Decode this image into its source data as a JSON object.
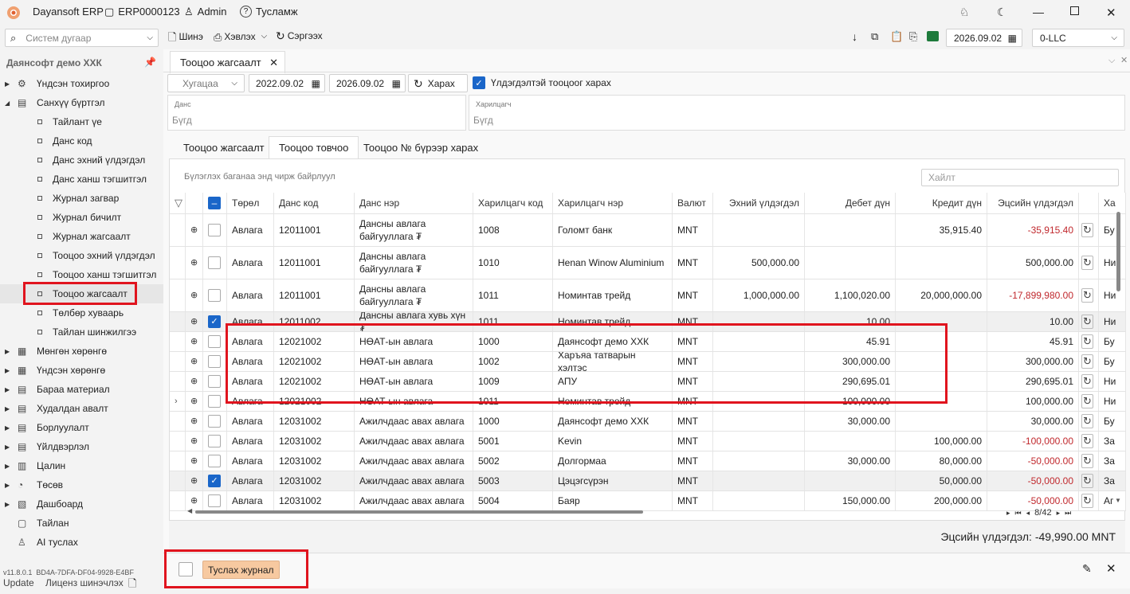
{
  "titlebar": {
    "app_name": "Dayansoft ERP",
    "db_name": "ERP0000123",
    "user": "Admin",
    "help": "Тусламж"
  },
  "toolbar": {
    "search_placeholder": "Систем дугаар",
    "new_label": "Шинэ",
    "print_label": "Хэвлэх",
    "refresh_label": "Сэргээх",
    "date": "2026.09.02",
    "company": "0-LLC"
  },
  "sidebar": {
    "company": "Даянсофт демо ХХК",
    "items_top": [
      {
        "label": "Үндсэн тохиргоо",
        "glyph": "⚙",
        "arrow": "▶"
      },
      {
        "label": "Санхүү бүртгэл",
        "glyph": "▤",
        "arrow": "◢"
      }
    ],
    "subitems": [
      "Тайлант үе",
      "Данс код",
      "Данс эхний үлдэгдэл",
      "Данс ханш тэгшитгэл",
      "Журнал загвар",
      "Журнал бичилт",
      "Журнал жагсаалт",
      "Тооцоо эхний үлдэгдэл",
      "Тооцоо ханш тэгшитгэл",
      "Тооцоо жагсаалт",
      "Төлбөр хуваарь",
      "Тайлан шинжилгээ"
    ],
    "items_bottom": [
      {
        "label": "Мөнгөн хөрөнгө",
        "glyph": "▦",
        "arrow": "▶"
      },
      {
        "label": "Үндсэн хөрөнгө",
        "glyph": "▦",
        "arrow": "▶"
      },
      {
        "label": "Бараа материал",
        "glyph": "▤",
        "arrow": "▶"
      },
      {
        "label": "Худалдан авалт",
        "glyph": "▤",
        "arrow": "▶"
      },
      {
        "label": "Борлуулалт",
        "glyph": "▤",
        "arrow": "▶"
      },
      {
        "label": "Үйлдвэрлэл",
        "glyph": "▤",
        "arrow": "▶"
      },
      {
        "label": "Цалин",
        "glyph": "▥",
        "arrow": "▶"
      },
      {
        "label": "Төсөв",
        "glyph": "◔",
        "arrow": "▶"
      },
      {
        "label": "Дашбоард",
        "glyph": "▧",
        "arrow": "▶"
      },
      {
        "label": "Тайлан",
        "glyph": "▢",
        "arrow": ""
      },
      {
        "label": "AI туслах",
        "glyph": "♙",
        "arrow": ""
      }
    ],
    "version": "v11.8.0.1",
    "license_key": "BD4A-7DFA-DF04-9928-E4BF",
    "update_label": "Update",
    "license_label": "Лиценз шинэчлэх"
  },
  "doc_tab": {
    "title": "Тооцоо жагсаалт"
  },
  "filters": {
    "period": "Хугацаа",
    "date_from": "2022.09.02",
    "date_to": "2026.09.02",
    "view_label": "Харах",
    "balance_only_label": "Үлдэгдэлтэй тооцоог харах",
    "account_label": "Данс",
    "account_value": "Бүгд",
    "partner_label": "Харилцагч",
    "partner_value": "Бүгд"
  },
  "subtabs": [
    "Тооцоо жагсаалт",
    "Тооцоо товчоо",
    "Тооцоо № бүрээр харах"
  ],
  "grid": {
    "group_hint": "Бүлэглэх баганаа энд чирж байрлуул",
    "search_placeholder": "Хайлт",
    "columns": [
      "Төрөл",
      "Данс код",
      "Данс нэр",
      "Харилцагч код",
      "Харилцагч нэр",
      "Валют",
      "Эхний үлдэгдэл",
      "Дебет дүн",
      "Кредит дүн",
      "Эцсийн үлдэгдэл",
      "Ха"
    ],
    "rows": [
      {
        "type": "Авлага",
        "acc": "12011001",
        "accname": "Дансны авлага байгууллага ₮",
        "pcode": "1008",
        "pname": "Голомт банк",
        "cur": "MNT",
        "open": "",
        "debit": "",
        "credit": "35,915.40",
        "close": "-35,915.40",
        "extra": "Бу",
        "checked": false
      },
      {
        "type": "Авлага",
        "acc": "12011001",
        "accname": "Дансны авлага байгууллага ₮",
        "pcode": "1010",
        "pname": "Henan Winow Aluminium",
        "cur": "MNT",
        "open": "500,000.00",
        "debit": "",
        "credit": "",
        "close": "500,000.00",
        "extra": "Ни",
        "checked": false
      },
      {
        "type": "Авлага",
        "acc": "12011001",
        "accname": "Дансны авлага байгууллага ₮",
        "pcode": "1011",
        "pname": "Номинтав трейд",
        "cur": "MNT",
        "open": "1,000,000.00",
        "debit": "1,100,020.00",
        "credit": "20,000,000.00",
        "close": "-17,899,980.00",
        "extra": "Ни",
        "checked": false
      },
      {
        "type": "Авлага",
        "acc": "12011002",
        "accname": "Дансны авлага хувь хүн ₮",
        "pcode": "1011",
        "pname": "Номинтав трейд",
        "cur": "MNT",
        "open": "",
        "debit": "10.00",
        "credit": "",
        "close": "10.00",
        "extra": "Ни",
        "checked": true
      },
      {
        "type": "Авлага",
        "acc": "12021002",
        "accname": "НӨАТ-ын авлага",
        "pcode": "1000",
        "pname": "Даянсофт демо ХХК",
        "cur": "MNT",
        "open": "",
        "debit": "45.91",
        "credit": "",
        "close": "45.91",
        "extra": "Бу",
        "checked": false
      },
      {
        "type": "Авлага",
        "acc": "12021002",
        "accname": "НӨАТ-ын авлага",
        "pcode": "1002",
        "pname": "Харъяа татварын хэлтэс",
        "cur": "MNT",
        "open": "",
        "debit": "300,000.00",
        "credit": "",
        "close": "300,000.00",
        "extra": "Бу",
        "checked": false
      },
      {
        "type": "Авлага",
        "acc": "12021002",
        "accname": "НӨАТ-ын авлага",
        "pcode": "1009",
        "pname": "АПУ",
        "cur": "MNT",
        "open": "",
        "debit": "290,695.01",
        "credit": "",
        "close": "290,695.01",
        "extra": "Ни",
        "checked": false
      },
      {
        "type": "Авлага",
        "acc": "12021002",
        "accname": "НӨАТ-ын авлага",
        "pcode": "1011",
        "pname": "Номинтав трейд",
        "cur": "MNT",
        "open": "",
        "debit": "100,000.00",
        "credit": "",
        "close": "100,000.00",
        "extra": "Ни",
        "checked": false
      },
      {
        "type": "Авлага",
        "acc": "12031002",
        "accname": "Ажилчдаас авах авлага",
        "pcode": "1000",
        "pname": "Даянсофт демо ХХК",
        "cur": "MNT",
        "open": "",
        "debit": "30,000.00",
        "credit": "",
        "close": "30,000.00",
        "extra": "Бу",
        "checked": false
      },
      {
        "type": "Авлага",
        "acc": "12031002",
        "accname": "Ажилчдаас авах авлага",
        "pcode": "5001",
        "pname": "Kevin",
        "cur": "MNT",
        "open": "",
        "debit": "",
        "credit": "100,000.00",
        "close": "-100,000.00",
        "extra": "За",
        "checked": false
      },
      {
        "type": "Авлага",
        "acc": "12031002",
        "accname": "Ажилчдаас авах авлага",
        "pcode": "5002",
        "pname": "Долгормаа",
        "cur": "MNT",
        "open": "",
        "debit": "30,000.00",
        "credit": "80,000.00",
        "close": "-50,000.00",
        "extra": "За",
        "checked": false
      },
      {
        "type": "Авлага",
        "acc": "12031002",
        "accname": "Ажилчдаас авах авлага",
        "pcode": "5003",
        "pname": "Цэцэгсүрэн",
        "cur": "MNT",
        "open": "",
        "debit": "",
        "credit": "50,000.00",
        "close": "-50,000.00",
        "extra": "За",
        "checked": true
      },
      {
        "type": "Авлага",
        "acc": "12031002",
        "accname": "Ажилчдаас авах авлага",
        "pcode": "5004",
        "pname": "Баяр",
        "cur": "MNT",
        "open": "",
        "debit": "150,000.00",
        "credit": "200,000.00",
        "close": "-50,000.00",
        "extra": "Аг",
        "checked": false
      }
    ],
    "pager": "8/42"
  },
  "summary": {
    "final_balance": "Эцсийн үлдэгдэл: -49,990.00 MNT"
  },
  "footer": {
    "journal_button": "Туслах журнал"
  },
  "colors": {
    "accent": "#1a66c9",
    "highlight": "#e0141e",
    "negative": "#c0282d",
    "journal_bg": "#f7c9a0"
  }
}
